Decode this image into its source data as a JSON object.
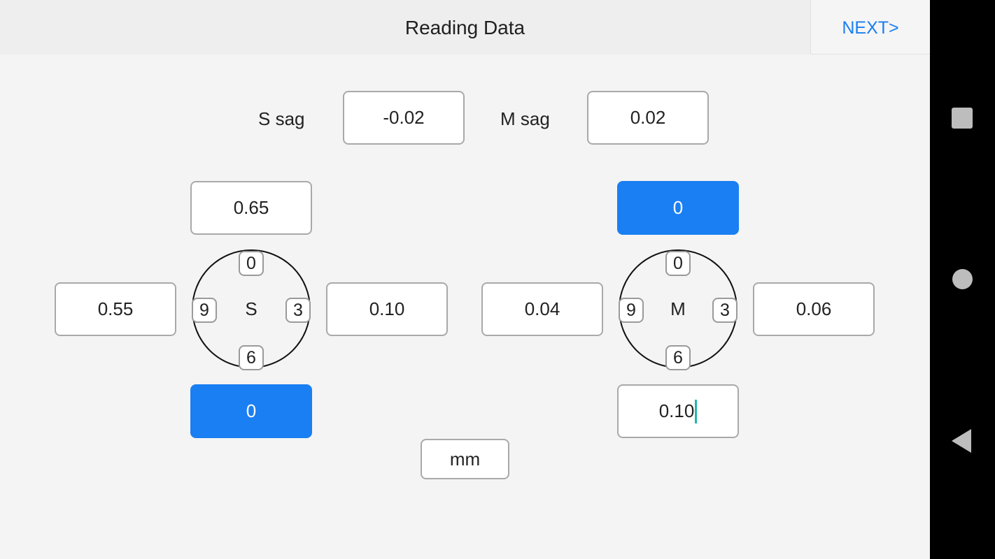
{
  "header": {
    "title": "Reading Data",
    "next_label": "NEXT>"
  },
  "sag": {
    "s_label": "S sag",
    "s_value": "-0.02",
    "m_label": "M sag",
    "m_value": "0.02"
  },
  "s_dial": {
    "center": "S",
    "tick_0": "0",
    "tick_3": "3",
    "tick_6": "6",
    "tick_9": "9",
    "top_value": "0.65",
    "left_value": "0.55",
    "right_value": "0.10",
    "bottom_value": "0",
    "bottom_selected": true
  },
  "m_dial": {
    "center": "M",
    "tick_0": "0",
    "tick_3": "3",
    "tick_6": "6",
    "tick_9": "9",
    "top_value": "0",
    "top_selected": true,
    "left_value": "0.04",
    "right_value": "0.06",
    "bottom_value": "0.10",
    "bottom_focused": true
  },
  "unit": {
    "label": "mm"
  },
  "colors": {
    "accent": "#1a7ff2",
    "caret": "#1fb8a8",
    "background": "#f4f4f4",
    "header_bg": "#eeeeee"
  },
  "navbar": {
    "recent_icon": "square-icon",
    "home_icon": "circle-icon",
    "back_icon": "triangle-back-icon"
  }
}
